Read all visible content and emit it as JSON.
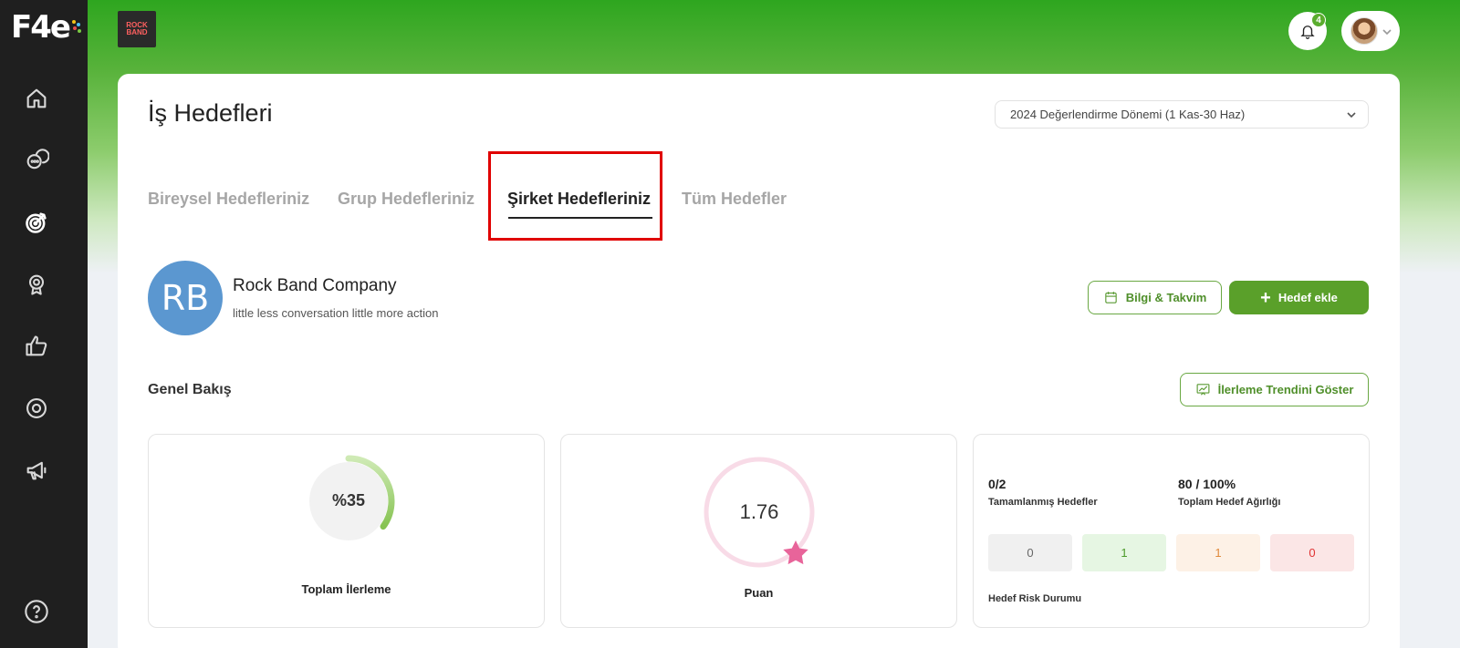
{
  "brand": {
    "logo_text": "F4e"
  },
  "header": {
    "company_logo_text": "ROCK BAND",
    "notification_count": "4"
  },
  "page": {
    "title": "İş Hedefleri",
    "period": "2024 Değerlendirme Dönemi (1 Kas-30 Haz)"
  },
  "tabs": [
    {
      "label": "Bireysel Hedefleriniz"
    },
    {
      "label": "Grup Hedefleriniz"
    },
    {
      "label": "Şirket Hedefleriniz"
    },
    {
      "label": "Tüm Hedefler"
    }
  ],
  "company": {
    "initials": "RB",
    "name": "Rock Band Company",
    "description": "little less conversation little more action"
  },
  "actions": {
    "info_calendar": "Bilgi & Takvim",
    "add_goal": "Hedef ekle",
    "show_trend": "İlerleme Trendini Göster"
  },
  "overview": {
    "title": "Genel Bakış",
    "progress": {
      "value_label": "%35",
      "fraction": 0.35,
      "label": "Toplam İlerleme"
    },
    "score": {
      "value": "1.76",
      "label": "Puan"
    },
    "summary": {
      "completed_value": "0/2",
      "completed_label": "Tamamlanmış Hedefler",
      "weight_value": "80 / 100%",
      "weight_label": "Toplam Hedef Ağırlığı",
      "risk_counts": [
        {
          "value": "0",
          "bg": "#f0f0f0",
          "color": "#666666"
        },
        {
          "value": "1",
          "bg": "#e6f6e3",
          "color": "#4c9a2a"
        },
        {
          "value": "1",
          "bg": "#fdf1e6",
          "color": "#e08a3c"
        },
        {
          "value": "0",
          "bg": "#fbe6e6",
          "color": "#e03333"
        }
      ],
      "risk_label": "Hedef Risk Durumu"
    }
  },
  "colors": {
    "accent_green": "#5aa02a",
    "sidebar": "#1f1f1f",
    "avatar_blue": "#5b97d0",
    "score_star": "#e8649a"
  }
}
